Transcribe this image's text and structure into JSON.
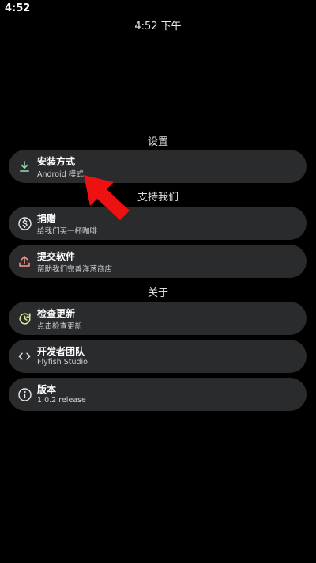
{
  "status_bar": {
    "time": "4:52"
  },
  "header": {
    "time": "4:52 下午"
  },
  "sections": {
    "settings": "设置",
    "support": "支持我们",
    "about": "关于"
  },
  "items": {
    "install": {
      "title": "安装方式",
      "subtitle": "Android 模式",
      "icon": "download-icon"
    },
    "donate": {
      "title": "捐赠",
      "subtitle": "给我们买一杯咖啡",
      "icon": "dollar-icon"
    },
    "submit": {
      "title": "提交软件",
      "subtitle": "帮助我们完善洋葱商店",
      "icon": "upload-icon"
    },
    "update": {
      "title": "检查更新",
      "subtitle": "点击检查更新",
      "icon": "update-icon"
    },
    "team": {
      "title": "开发者团队",
      "subtitle": "Flyfish Studio",
      "icon": "code-icon"
    },
    "version": {
      "title": "版本",
      "subtitle": "1.0.2 release",
      "icon": "info-icon"
    }
  },
  "colors": {
    "background": "#000000",
    "card": "#2a2b2d",
    "install_icon": "#9ed9b0",
    "submit_icon": "#ff9a8a",
    "update_icon": "#d8e49a",
    "annotation_arrow": "#ee1111"
  }
}
